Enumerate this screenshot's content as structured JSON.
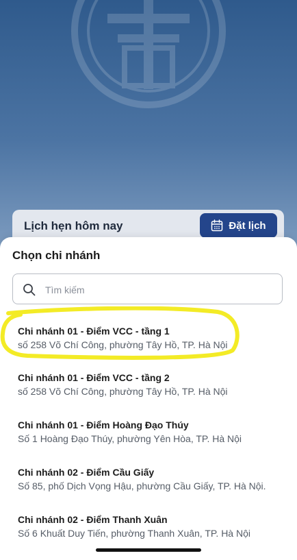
{
  "today": {
    "title": "Lịch hẹn hôm nay",
    "book_label": "Đặt lịch"
  },
  "sheet": {
    "title": "Chọn chi nhánh",
    "search_placeholder": "Tìm kiếm",
    "branches": [
      {
        "name": "Chi nhánh 01 -  Điểm VCC  - tầng 1",
        "address": "số 258 Võ Chí Công, phường Tây Hồ, TP. Hà Nội",
        "highlighted": true
      },
      {
        "name": "Chi nhánh 01 -  Điểm VCC  - tầng 2",
        "address": "số 258 Võ Chí Công, phường Tây Hồ, TP. Hà Nội"
      },
      {
        "name": "Chi nhánh 01 - Điểm Hoàng Đạo Thúy",
        "address": "Số 1 Hoàng Đạo Thúy, phường Yên Hòa, TP. Hà Nội"
      },
      {
        "name": "Chi nhánh 02 - Điểm Cầu Giấy",
        "address": "Số 85, phố Dịch Vọng Hậu, phường Cầu Giấy, TP. Hà Nội."
      },
      {
        "name": "Chi nhánh 02 - Điểm Thanh Xuân",
        "address": "Số 6 Khuất Duy Tiến, phường Thanh Xuân, TP. Hà Nội"
      }
    ]
  },
  "colors": {
    "primary": "#24458b",
    "highlight": "#f2ea1a"
  },
  "icons": {
    "calendar": "calendar-icon",
    "search": "search-icon",
    "emblem": "emblem-icon"
  }
}
